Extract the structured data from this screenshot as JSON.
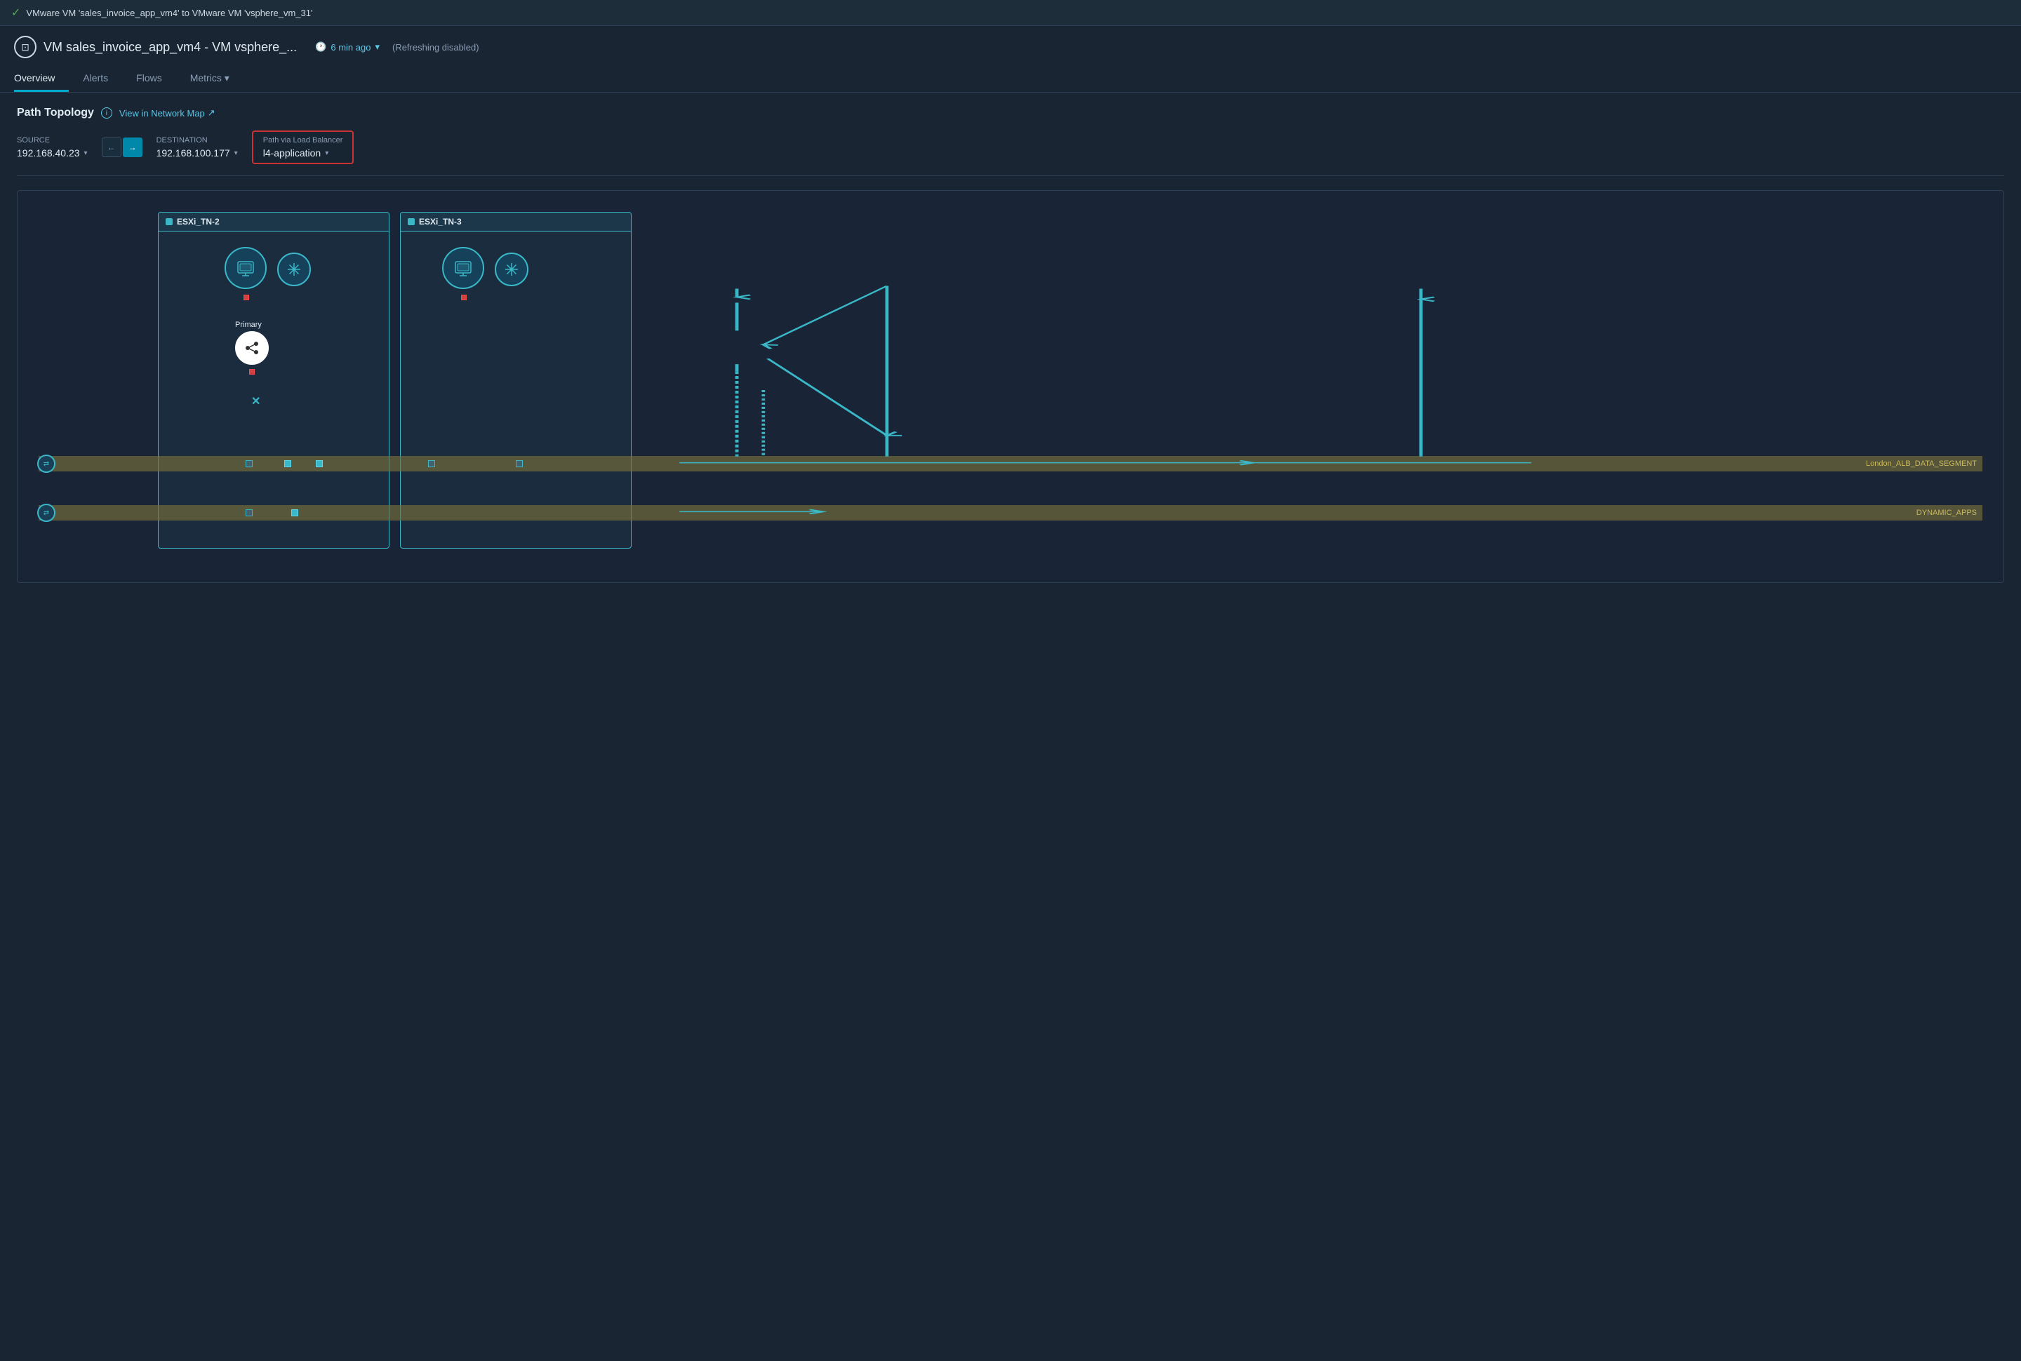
{
  "topbar": {
    "status_icon": "✓",
    "status_text": "VMware VM 'sales_invoice_app_vm4' to VMware VM 'vsphere_vm_31'"
  },
  "header": {
    "vm_icon": "⊡",
    "title": "VM sales_invoice_app_vm4 - VM vsphere_...",
    "time_label": "6 min ago",
    "time_dropdown": "▾",
    "refresh_status": "(Refreshing  disabled)"
  },
  "nav": {
    "tabs": [
      {
        "id": "overview",
        "label": "Overview",
        "active": true
      },
      {
        "id": "alerts",
        "label": "Alerts",
        "active": false
      },
      {
        "id": "flows",
        "label": "Flows",
        "active": false
      },
      {
        "id": "metrics",
        "label": "Metrics",
        "active": false
      }
    ]
  },
  "path_topology": {
    "title": "Path Topology",
    "info_icon": "i",
    "view_network_label": "View in Network Map",
    "view_network_icon": "↗"
  },
  "controls": {
    "source_label": "Source",
    "source_value": "192.168.40.23",
    "source_dropdown": "▾",
    "direction_left": "←",
    "direction_right": "→",
    "destination_label": "Destination",
    "destination_value": "192.168.100.177",
    "destination_dropdown": "▾",
    "path_via_label": "Path via Load Balancer",
    "path_via_value": "l4-application",
    "path_via_dropdown": "▾"
  },
  "topology": {
    "esxi_left_label": "ESXi_TN-2",
    "esxi_right_label": "ESXi_TN-3",
    "primary_label": "Primary",
    "segment_top_label": "London_ALB_DATA_SEGMENT",
    "segment_bottom_label": "DYNAMIC_APPS"
  },
  "colors": {
    "accent": "#3ab8c8",
    "accent_dim": "#0088aa",
    "bg_dark": "#1a2533",
    "bg_panel": "#1e2d3a",
    "border": "#2e4055",
    "active_tab": "#00aacc",
    "segment_bg": "rgba(120,110,60,0.7)",
    "segment_text": "#c8b860",
    "error_red": "#cc3333",
    "text_primary": "#e0eaf2",
    "text_secondary": "#8a9db5"
  }
}
